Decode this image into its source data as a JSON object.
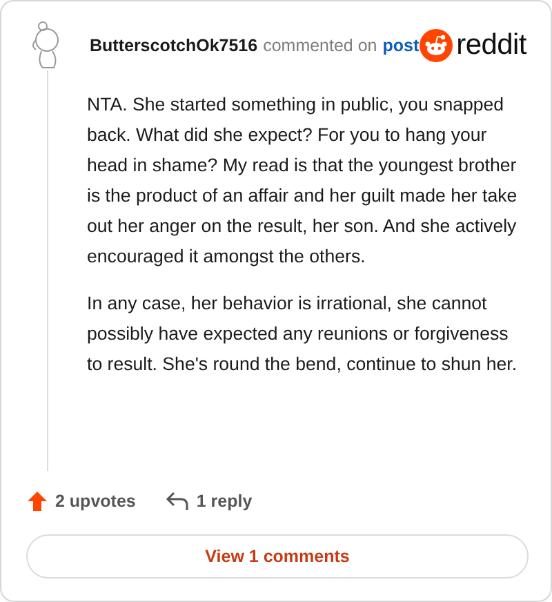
{
  "comment": {
    "author": "ButterscotchOk7516",
    "action": "commented on",
    "link": "post",
    "paragraphs": [
      "NTA. She started something in public, you snapped back. What did she expect? For you to hang your head in shame? My read is that the youngest brother is the product of an affair and her guilt made her take out her anger on the result, her son. And she actively encouraged it amongst the others.",
      "In any case, her behavior is irrational, she cannot possibly have expected any reunions or forgiveness to result. She's round the bend, continue to shun her."
    ],
    "upvotes": "2 upvotes",
    "replies": "1 reply"
  },
  "brand": "reddit",
  "view_button": "View 1 comments"
}
